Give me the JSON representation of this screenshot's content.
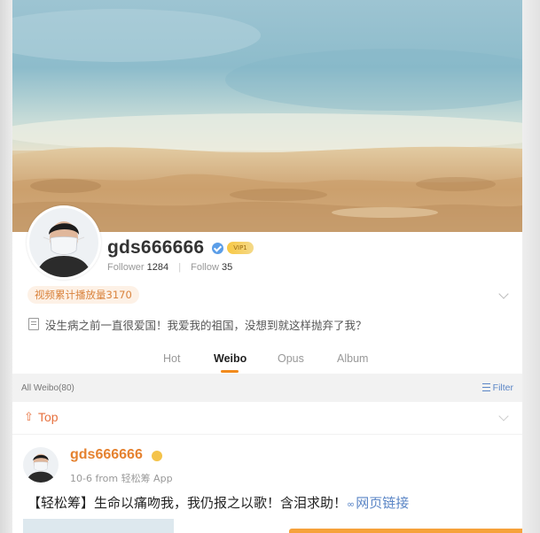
{
  "profile": {
    "username": "gds666666",
    "vip_badge": "VIP1",
    "follower_label": "Follower",
    "follower_count": "1284",
    "follow_label": "Follow",
    "follow_count": "35",
    "play_count_badge": "视频累计播放量3170",
    "bio": "没生病之前一直很爱国！我爱我的祖国，没想到就这样抛弃了我？"
  },
  "tabs": [
    {
      "label": "Hot",
      "active": false
    },
    {
      "label": "Weibo",
      "active": true
    },
    {
      "label": "Opus",
      "active": false
    },
    {
      "label": "Album",
      "active": false
    }
  ],
  "feed": {
    "all_label": "All Weibo(80)",
    "filter_label": "Filter",
    "top_label": "Top"
  },
  "post": {
    "username": "gds666666",
    "date": "10-6",
    "source": "from 轻松筹 App",
    "text": "【轻松筹】生命以痛吻我，我仍报之以歌！含泪求助！",
    "link_label": "网页链接"
  },
  "colors": {
    "accent_orange": "#f18a1c",
    "link_blue": "#5b86c6",
    "top_orange": "#e7713e"
  },
  "icons": [
    "verified-icon",
    "vip-badge-icon",
    "chevron-down-icon",
    "document-icon",
    "filter-icon",
    "pin-top-icon",
    "link-icon"
  ]
}
